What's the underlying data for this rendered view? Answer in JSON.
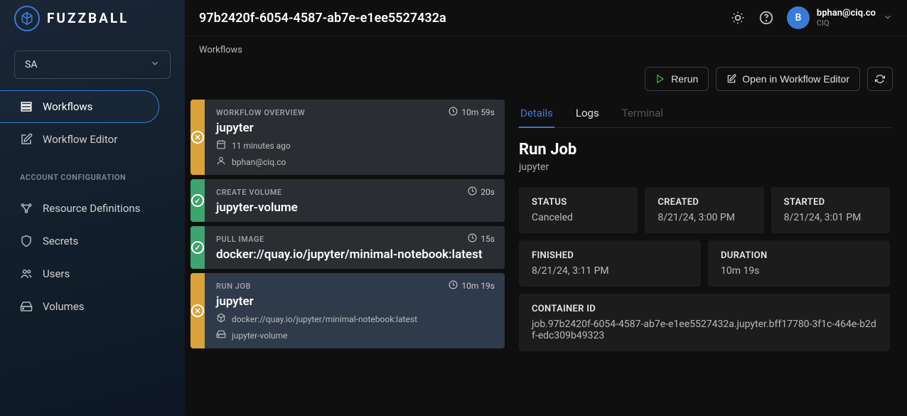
{
  "brand": {
    "name": "FUZZBALL"
  },
  "org_selector": {
    "value": "SA"
  },
  "sidebar": {
    "items": [
      {
        "label": "Workflows"
      },
      {
        "label": "Workflow Editor"
      }
    ],
    "config_header": "ACCOUNT CONFIGURATION",
    "config_items": [
      {
        "label": "Resource Definitions"
      },
      {
        "label": "Secrets"
      },
      {
        "label": "Users"
      },
      {
        "label": "Volumes"
      }
    ]
  },
  "header": {
    "title": "97b2420f-6054-4587-ab7e-e1ee5527432a",
    "user": {
      "initial": "B",
      "email": "bphan@ciq.co",
      "org": "CIQ"
    }
  },
  "breadcrumb": "Workflows",
  "actions": {
    "rerun": "Rerun",
    "open_editor": "Open in Workflow Editor"
  },
  "steps": [
    {
      "kicker": "WORKFLOW OVERVIEW",
      "title": "jupyter",
      "duration": "10m 59s",
      "meta": [
        {
          "icon": "calendar",
          "text": "11 minutes ago"
        },
        {
          "icon": "user",
          "text": "bphan@ciq.co"
        }
      ],
      "status": "warn"
    },
    {
      "kicker": "CREATE VOLUME",
      "title": "jupyter-volume",
      "duration": "20s",
      "meta": [],
      "status": "ok"
    },
    {
      "kicker": "PULL IMAGE",
      "title": "docker://quay.io/jupyter/minimal-notebook:latest",
      "duration": "15s",
      "meta": [],
      "status": "ok"
    },
    {
      "kicker": "RUN JOB",
      "title": "jupyter",
      "duration": "10m 19s",
      "meta": [
        {
          "icon": "cube",
          "text": "docker://quay.io/jupyter/minimal-notebook:latest"
        },
        {
          "icon": "disk",
          "text": "jupyter-volume"
        }
      ],
      "status": "warn",
      "selected": true
    }
  ],
  "tabs": [
    {
      "label": "Details",
      "state": "active"
    },
    {
      "label": "Logs",
      "state": "normal"
    },
    {
      "label": "Terminal",
      "state": "disabled"
    }
  ],
  "details": {
    "title": "Run Job",
    "subtitle": "jupyter",
    "cards": [
      {
        "label": "STATUS",
        "value": "Canceled"
      },
      {
        "label": "CREATED",
        "value": "8/21/24, 3:00 PM"
      },
      {
        "label": "STARTED",
        "value": "8/21/24, 3:01 PM"
      },
      {
        "label": "FINISHED",
        "value": "8/21/24, 3:11 PM"
      },
      {
        "label": "DURATION",
        "value": "10m 19s"
      }
    ],
    "container": {
      "label": "CONTAINER ID",
      "value": "job.97b2420f-6054-4587-ab7e-e1ee5527432a.jupyter.bff17780-3f1c-464e-b2df-edc309b49323"
    }
  }
}
